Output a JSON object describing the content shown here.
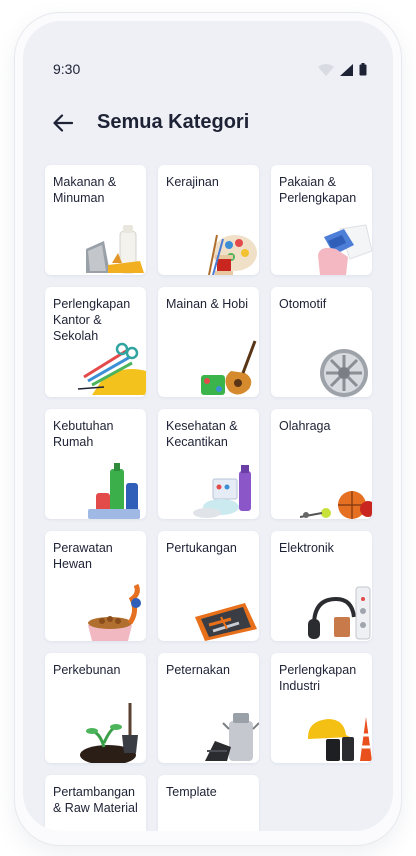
{
  "status_bar": {
    "time": "9:30"
  },
  "header": {
    "title": "Semua Kategori"
  },
  "categories": [
    {
      "label": "Makanan & Minuman",
      "icon": "food-groceries-icon"
    },
    {
      "label": "Kerajinan",
      "icon": "craft-supplies-icon"
    },
    {
      "label": "Pakaian & Perlengkapan",
      "icon": "clothing-icon"
    },
    {
      "label": "Perlengkapan Kantor & Sekolah",
      "icon": "office-supplies-icon"
    },
    {
      "label": "Mainan & Hobi",
      "icon": "guitar-toys-icon"
    },
    {
      "label": "Otomotif",
      "icon": "car-wheel-icon"
    },
    {
      "label": "Kebutuhan Rumah",
      "icon": "household-cleaning-icon"
    },
    {
      "label": "Kesehatan & Kecantikan",
      "icon": "health-beauty-icon"
    },
    {
      "label": "Olahraga",
      "icon": "sports-balls-icon"
    },
    {
      "label": "Perawatan Hewan",
      "icon": "pet-food-icon"
    },
    {
      "label": "Pertukangan",
      "icon": "toolbox-icon"
    },
    {
      "label": "Elektronik",
      "icon": "headphones-electronics-icon"
    },
    {
      "label": "Perkebunan",
      "icon": "plant-shovel-icon"
    },
    {
      "label": "Peternakan",
      "icon": "milk-can-icon"
    },
    {
      "label": "Perlengkapan Industri",
      "icon": "safety-helmet-icon"
    },
    {
      "label": "Pertambangan & Raw Material",
      "icon": "mining-icon"
    },
    {
      "label": "Template",
      "icon": "template-icon"
    }
  ]
}
